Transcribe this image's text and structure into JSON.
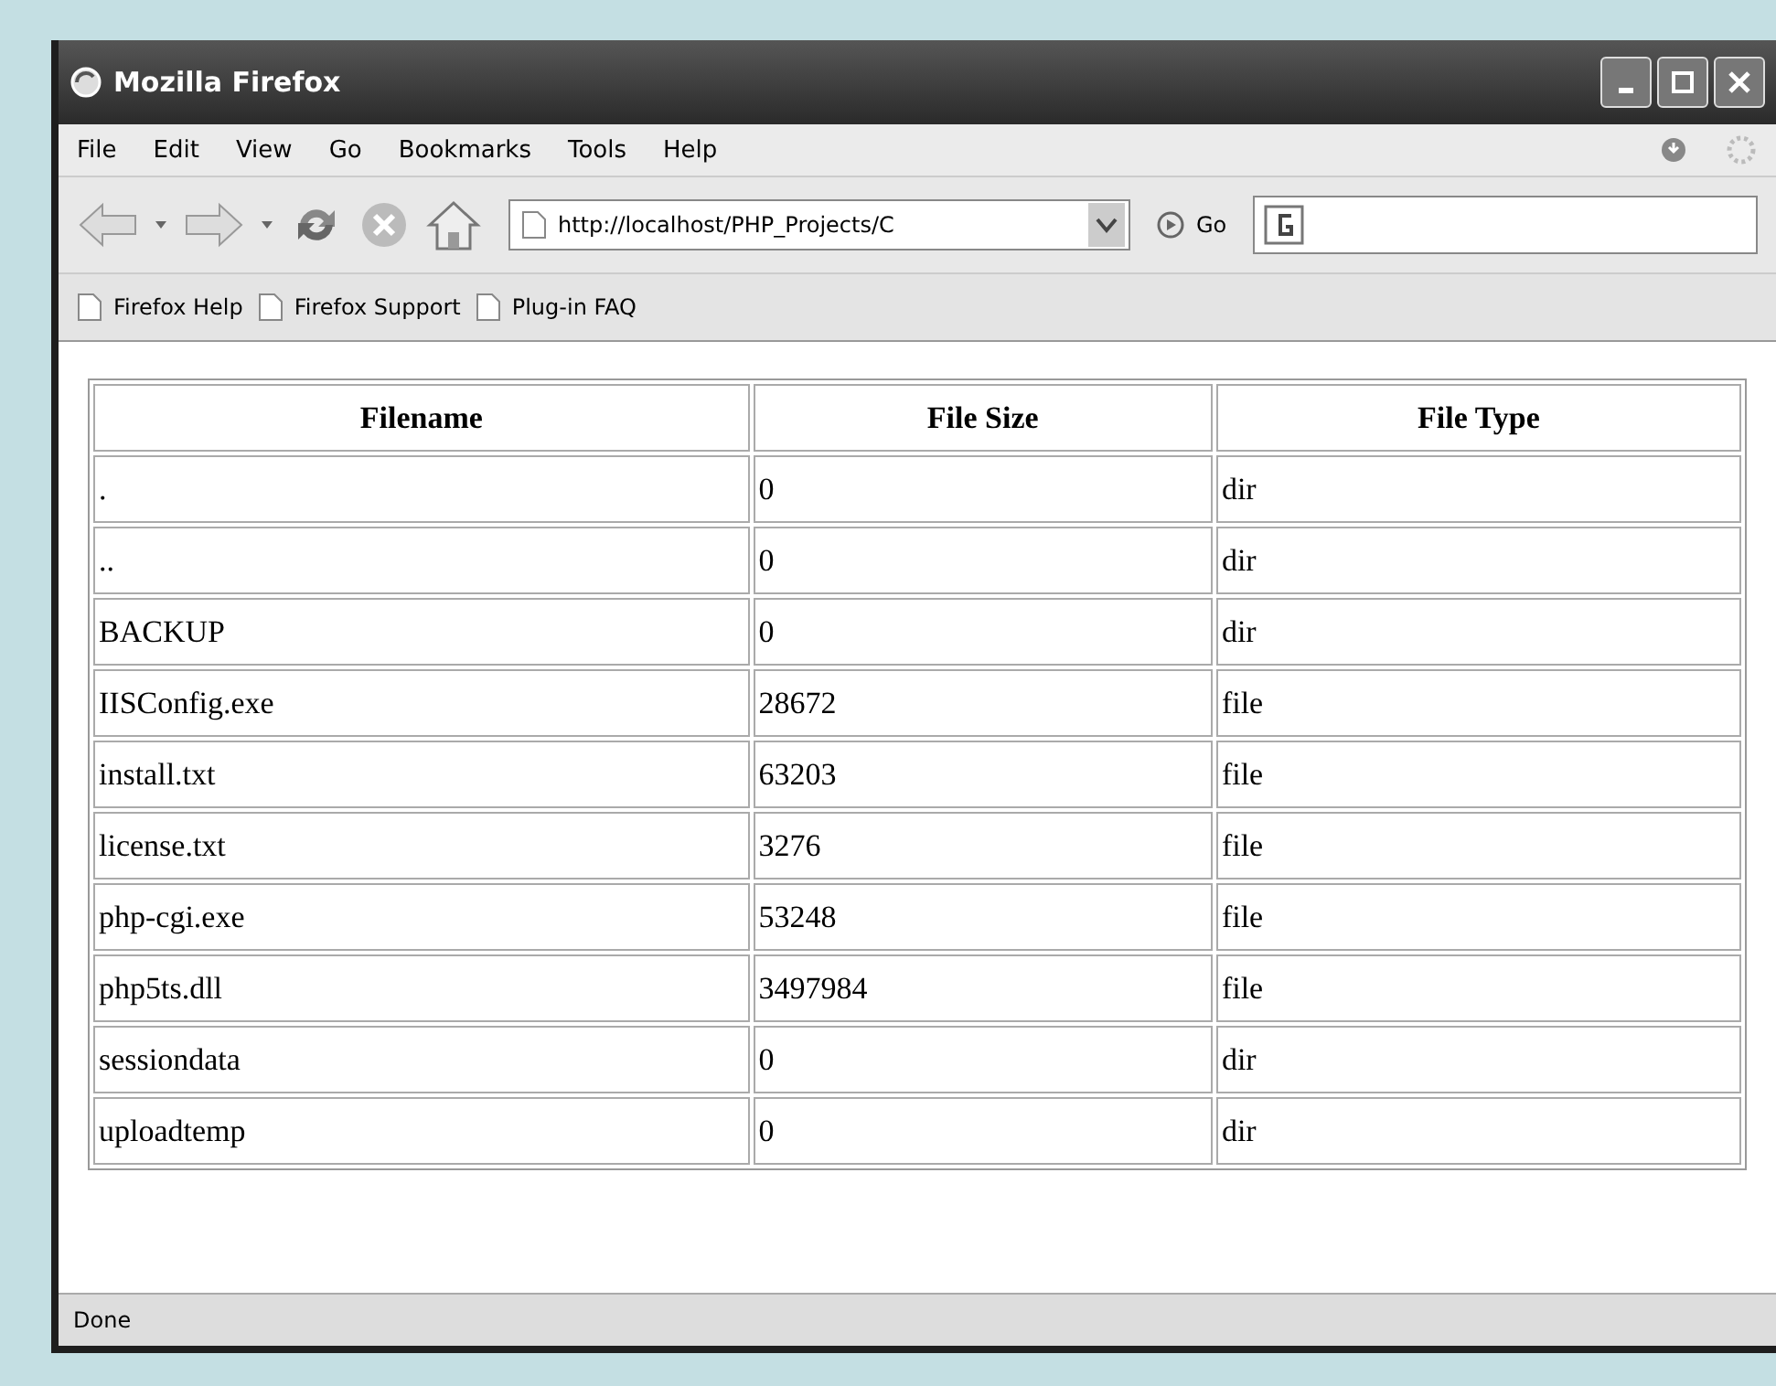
{
  "window": {
    "title": "Mozilla Firefox"
  },
  "menu": [
    "File",
    "Edit",
    "View",
    "Go",
    "Bookmarks",
    "Tools",
    "Help"
  ],
  "toolbar": {
    "address": "http://localhost/PHP_Projects/C",
    "go": "Go"
  },
  "bookmarks": [
    "Firefox Help",
    "Firefox Support",
    "Plug-in FAQ"
  ],
  "table": {
    "columns": [
      "Filename",
      "File Size",
      "File Type"
    ],
    "rows": [
      [
        ".",
        "0",
        "dir"
      ],
      [
        "..",
        "0",
        "dir"
      ],
      [
        "BACKUP",
        "0",
        "dir"
      ],
      [
        "IISConfig.exe",
        "28672",
        "file"
      ],
      [
        "install.txt",
        "63203",
        "file"
      ],
      [
        "license.txt",
        "3276",
        "file"
      ],
      [
        "php-cgi.exe",
        "53248",
        "file"
      ],
      [
        "php5ts.dll",
        "3497984",
        "file"
      ],
      [
        "sessiondata",
        "0",
        "dir"
      ],
      [
        "uploadtemp",
        "0",
        "dir"
      ]
    ]
  },
  "status_bar": "Done"
}
